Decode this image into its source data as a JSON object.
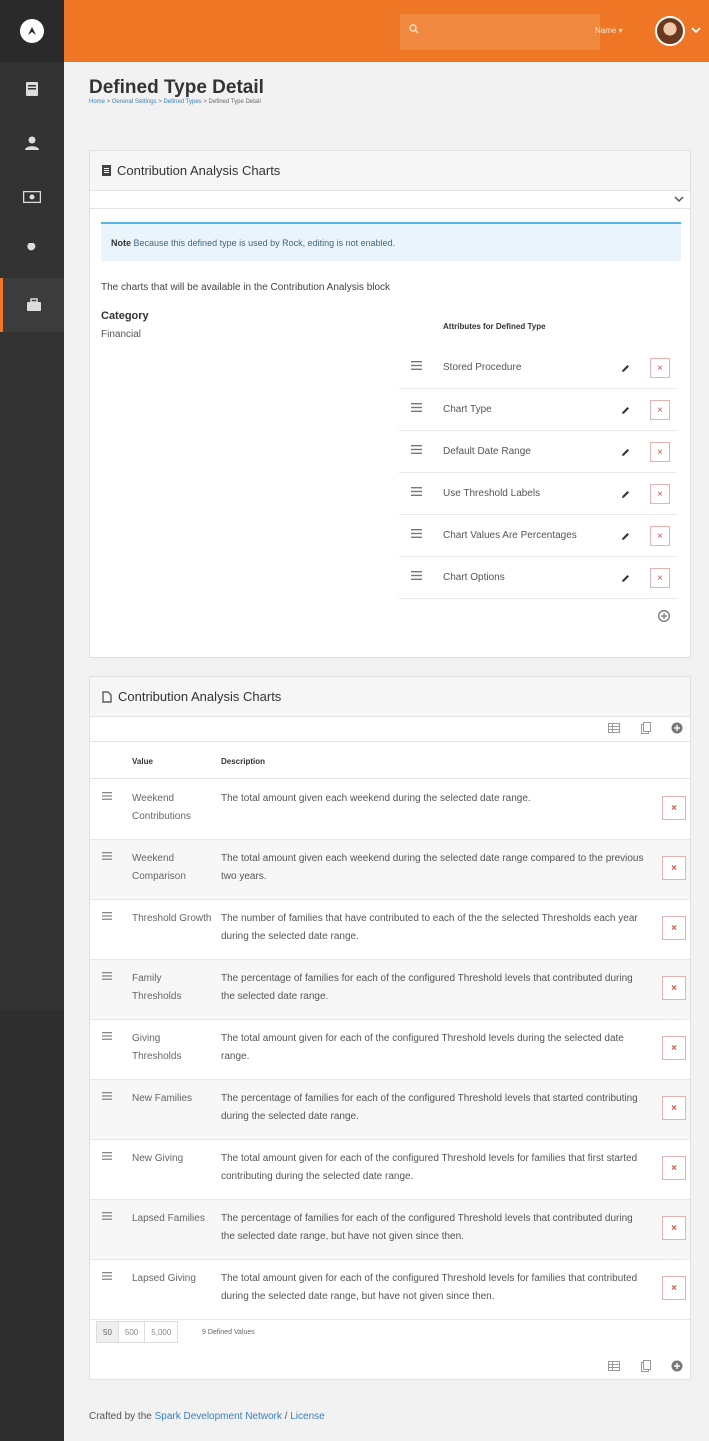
{
  "nav": {
    "items": [
      {
        "name": "nav-item-pages",
        "icon": "book-icon"
      },
      {
        "name": "nav-item-people",
        "icon": "person-icon"
      },
      {
        "name": "nav-item-finance",
        "icon": "money-icon"
      },
      {
        "name": "nav-item-tools",
        "icon": "wrench-icon"
      },
      {
        "name": "nav-item-admin",
        "icon": "briefcase-icon"
      }
    ]
  },
  "topbar": {
    "name_label": "Name ▾"
  },
  "header": {
    "title": "Defined Type Detail",
    "breadcrumb": [
      "Home",
      "General Settings",
      "Defined Types",
      "Defined Type Detail"
    ],
    "separator": ">"
  },
  "detail_panel": {
    "title": "Contribution Analysis Charts",
    "note_strong": "Note",
    "note_text": "Because this defined type is used by Rock, editing is not enabled.",
    "description": "The charts that will be available in the Contribution Analysis block",
    "category_label": "Category",
    "category_value": "Financial",
    "attributes_header": "Attributes for Defined Type",
    "attributes": [
      "Stored Procedure",
      "Chart Type",
      "Default Date Range",
      "Use Threshold Labels",
      "Chart Values Are Percentages",
      "Chart Options"
    ]
  },
  "values_panel": {
    "title": "Contribution Analysis Charts",
    "columns": {
      "value": "Value",
      "description": "Description"
    },
    "rows": [
      {
        "value": "Weekend Contributions",
        "description": "The total amount given each weekend during the selected date range."
      },
      {
        "value": "Weekend Comparison",
        "description": "The total amount given each weekend during the selected date range compared to the previous two years."
      },
      {
        "value": "Threshold Growth",
        "description": "The number of families that have contributed to each of the the selected Thresholds each year during the selected date range."
      },
      {
        "value": "Family Thresholds",
        "description": "The percentage of families for each of the configured Threshold levels that contributed during the selected date range."
      },
      {
        "value": "Giving Thresholds",
        "description": "The total amount given for each of the configured Threshold levels during the selected date range."
      },
      {
        "value": "New Families",
        "description": "The percentage of families for each of the configured Threshold levels that started contributing during the selected date range."
      },
      {
        "value": "New Giving",
        "description": "The total amount given for each of the configured Threshold levels for families that first started contributing during the selected date range."
      },
      {
        "value": "Lapsed Families",
        "description": "The percentage of families for each of the configured Threshold levels that contributed during the selected date range, but have not given since then."
      },
      {
        "value": "Lapsed Giving",
        "description": "The total amount given for each of the configured Threshold levels for families that contributed during the selected date range, but have not given since then."
      }
    ],
    "page_sizes": [
      "50",
      "500",
      "5,000"
    ],
    "count_text": "9 Defined Values",
    "delete_glyph": "×"
  },
  "footer": {
    "prefix": "Crafted by the ",
    "link1": "Spark Development Network",
    "sep": " / ",
    "link2": "License"
  },
  "colors": {
    "accent": "#ee7625",
    "sidebar": "#333333",
    "danger": "#d9534f",
    "link": "#3a7fc0"
  }
}
